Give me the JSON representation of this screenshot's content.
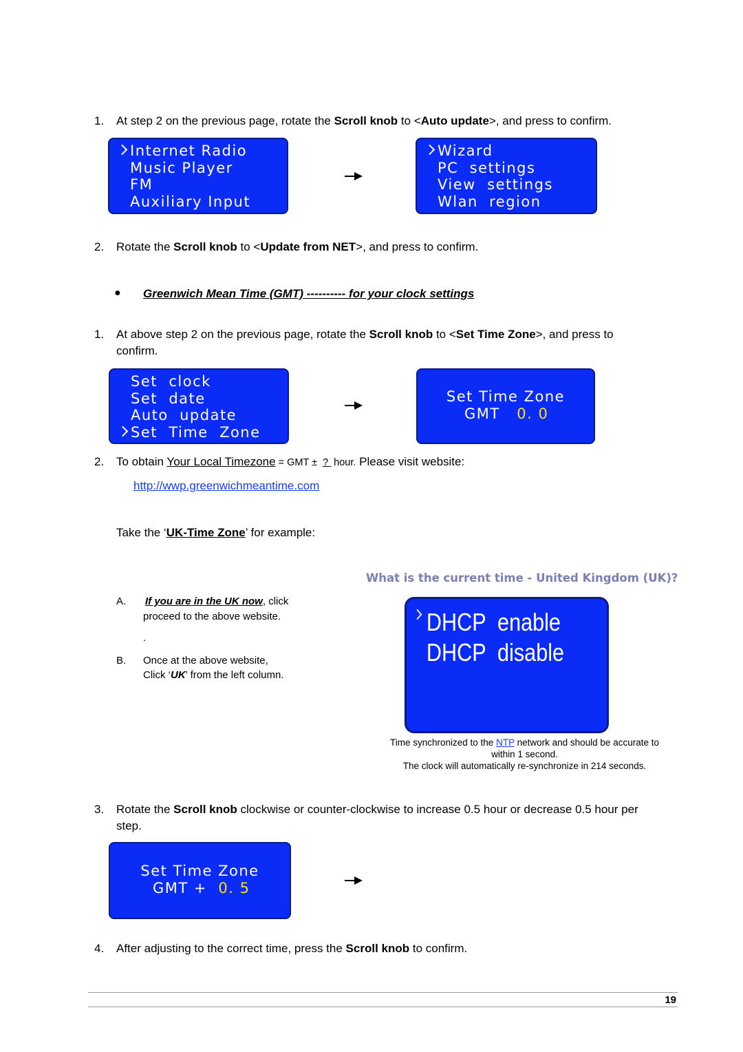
{
  "step1a": {
    "num": "1.",
    "pre": "At step 2 on the previous page, rotate the ",
    "b1": "Scroll knob",
    "mid": " to <",
    "b2": "Auto update",
    "post": ">, and press to confirm."
  },
  "screen1": [
    "Internet Radio",
    "Music Player",
    "FM",
    "Auxiliary Input"
  ],
  "screen2": [
    "Wizard",
    "PC  settings",
    "View  settings",
    "Wlan  region"
  ],
  "step2a": {
    "num": "2.",
    "pre": "Rotate the ",
    "b1": "Scroll knob",
    "mid": " to <",
    "b2": "Update from NET",
    "post": ">, and press to confirm."
  },
  "gmt_heading": "Greenwich Mean Time (GMT)  ---------- for your clock settings",
  "step1b": {
    "num": "1.",
    "pre": "At above step 2 on the previous page, rotate the ",
    "b1": "Scroll knob",
    "mid": " to <",
    "b2": "Set Time Zone",
    "post": ">, and press to",
    "line2": "confirm."
  },
  "screen3": [
    "Set  clock",
    "Set  date",
    "Auto  update",
    "Set  Time  Zone"
  ],
  "screen4": {
    "line1": "Set Time Zone",
    "gmt": "GMT",
    "value": "0. 0"
  },
  "step2b": {
    "num": "2.",
    "pre": "To obtain ",
    "u": "Your Local Timezone",
    "mid": " = GMT ± ",
    "q": " ? ",
    "post": " hour.",
    "post2": " Please visit website:"
  },
  "link": "http://wwp.greenwichmeantime.com",
  "example": {
    "pre": "Take the ‘",
    "u": "UK-Time Zone",
    "post": "’ for example:"
  },
  "website_title": "What is the current time - United Kingdom (UK)?",
  "stepA": {
    "label": "A.",
    "link": "If you are in the UK now",
    "post": ", click",
    "line2": "proceed to the above website.",
    "dot": "."
  },
  "stepB": {
    "label": "B.",
    "line1": "Once at the above website,",
    "pre": "Click ‘",
    "b": "UK",
    "post": "’ from the left column."
  },
  "screen5": [
    "DHCP  enable",
    "DHCP  disable"
  ],
  "caption": {
    "pre": "Time synchronized to the ",
    "ntp": "NTP",
    "post": " network and should be accurate to",
    "line2": "within 1 second.",
    "line3": "The clock will automatically re-synchronize in 214 seconds."
  },
  "step3": {
    "num": "3.",
    "pre": "Rotate the ",
    "b": "Scroll knob",
    "post": " clockwise or counter-clockwise to increase 0.5 hour or decrease 0.5 hour per",
    "line2": "step."
  },
  "screen6": {
    "line1": "Set Time Zone",
    "gmt": "GMT +",
    "value": "0. 5"
  },
  "step4": {
    "num": "4.",
    "pre": "After adjusting to the correct time, press the ",
    "b": "Scroll knob",
    "post": " to confirm."
  },
  "page_number": "19"
}
